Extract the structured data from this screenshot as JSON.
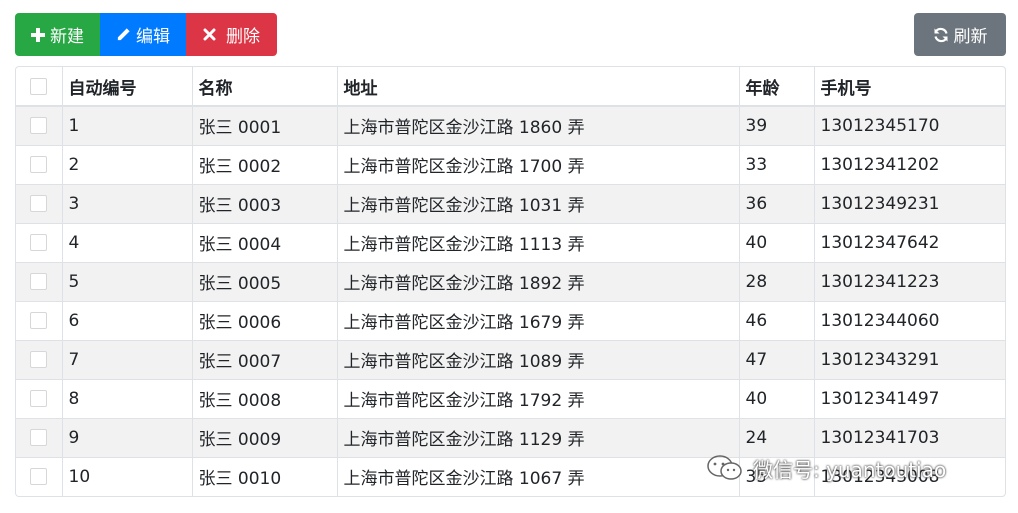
{
  "toolbar": {
    "new_label": "新建",
    "edit_label": "编辑",
    "delete_label": "删除",
    "refresh_label": "刷新"
  },
  "colors": {
    "new": "#28a745",
    "edit": "#007bff",
    "delete": "#dc3545",
    "refresh": "#6c757d"
  },
  "table": {
    "headers": [
      "",
      "自动编号",
      "名称",
      "地址",
      "年龄",
      "手机号"
    ],
    "rows": [
      [
        "1",
        "张三 0001",
        "上海市普陀区金沙江路 1860 弄",
        "39",
        "13012345170"
      ],
      [
        "2",
        "张三 0002",
        "上海市普陀区金沙江路 1700 弄",
        "33",
        "13012341202"
      ],
      [
        "3",
        "张三 0003",
        "上海市普陀区金沙江路 1031 弄",
        "36",
        "13012349231"
      ],
      [
        "4",
        "张三 0004",
        "上海市普陀区金沙江路 1113 弄",
        "40",
        "13012347642"
      ],
      [
        "5",
        "张三 0005",
        "上海市普陀区金沙江路 1892 弄",
        "28",
        "13012341223"
      ],
      [
        "6",
        "张三 0006",
        "上海市普陀区金沙江路 1679 弄",
        "46",
        "13012344060"
      ],
      [
        "7",
        "张三 0007",
        "上海市普陀区金沙江路 1089 弄",
        "47",
        "13012343291"
      ],
      [
        "8",
        "张三 0008",
        "上海市普陀区金沙江路 1792 弄",
        "40",
        "13012341497"
      ],
      [
        "9",
        "张三 0009",
        "上海市普陀区金沙江路 1129 弄",
        "24",
        "13012341703"
      ],
      [
        "10",
        "张三 0010",
        "上海市普陀区金沙江路 1067 弄",
        "35",
        "13012343008"
      ]
    ]
  },
  "watermark": {
    "text": "微信号: yuantoutiao",
    "icon": "wechat-icon"
  }
}
